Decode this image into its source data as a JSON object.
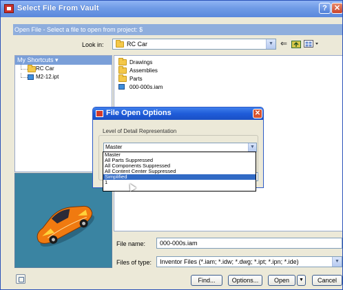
{
  "window": {
    "title": "Select File From Vault",
    "help_label": "?",
    "close_label": "✕"
  },
  "project_bar": {
    "text": "Open File - Select a file to open from project: $"
  },
  "look_in": {
    "label": "Look in:",
    "value": "RC Car"
  },
  "shortcuts": {
    "header": "My Shortcuts ▾",
    "items": [
      {
        "label": "RC Car",
        "icon": "folder-icon"
      },
      {
        "label": "M2-12.ipt",
        "icon": "part-icon"
      }
    ]
  },
  "file_list": {
    "items": [
      {
        "label": "Drawings",
        "icon": "folder-icon"
      },
      {
        "label": "Assemblies",
        "icon": "folder-icon"
      },
      {
        "label": "Parts",
        "icon": "folder-icon"
      },
      {
        "label": "000-000s.iam",
        "icon": "assembly-icon"
      }
    ]
  },
  "file_name": {
    "label": "File name:",
    "value": "000-000s.iam"
  },
  "file_type": {
    "label": "Files of type:",
    "value": "Inventor Files (*.iam; *.idw; *.dwg; *.ipt; *.ipn; *.ide)"
  },
  "buttons": {
    "find": "Find...",
    "options": "Options...",
    "open": "Open",
    "cancel": "Cancel"
  },
  "dialog": {
    "title": "File Open Options",
    "close_label": "✕",
    "lod_label": "Level of Detail Representation",
    "lod_value": "Master",
    "options": [
      {
        "label": "Master",
        "selected": false
      },
      {
        "label": "All Parts Suppressed",
        "selected": false
      },
      {
        "label": "All Components Suppressed",
        "selected": false
      },
      {
        "label": "All Content Center Suppressed",
        "selected": false
      },
      {
        "label": "Simplified",
        "selected": true
      },
      {
        "label": "1",
        "selected": false
      }
    ]
  },
  "colors": {
    "selection": "#316ac5",
    "preview_bg": "#3a84a2",
    "car_orange": "#f07a10"
  }
}
